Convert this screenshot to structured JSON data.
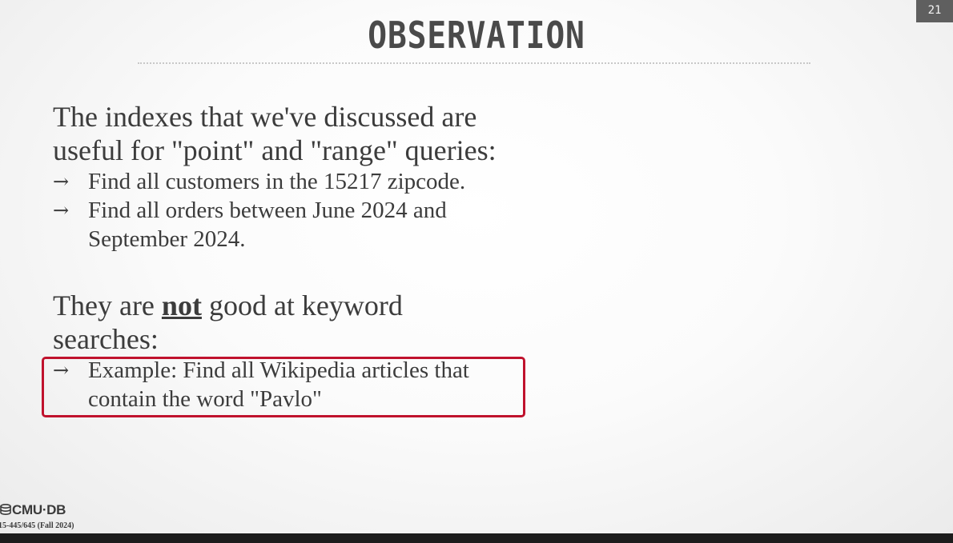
{
  "slide": {
    "title": "OBSERVATION",
    "page_number": "21"
  },
  "content": {
    "point1": {
      "line1": "The indexes that we've discussed are",
      "line2": "useful for \"point\" and \"range\" queries:",
      "items": [
        {
          "line1": "Find all customers in the 15217 zipcode."
        },
        {
          "line1": "Find all orders between June 2024 and",
          "line2": "September 2024."
        }
      ]
    },
    "point2": {
      "before": "They are ",
      "emphasis": "not",
      "after": " good at keyword",
      "line2": "searches:",
      "items": [
        {
          "line1": "Example: Find all Wikipedia articles that",
          "line2": "contain the word \"Pavlo\""
        }
      ]
    },
    "arrow_glyph": "→"
  },
  "footer": {
    "logo_text": "CMU·DB",
    "course": "15-445/645 (Fall 2024)"
  },
  "colors": {
    "highlight_border": "#c0122d",
    "title_text": "#4a4a4a",
    "body_text": "#3c3c3c"
  }
}
